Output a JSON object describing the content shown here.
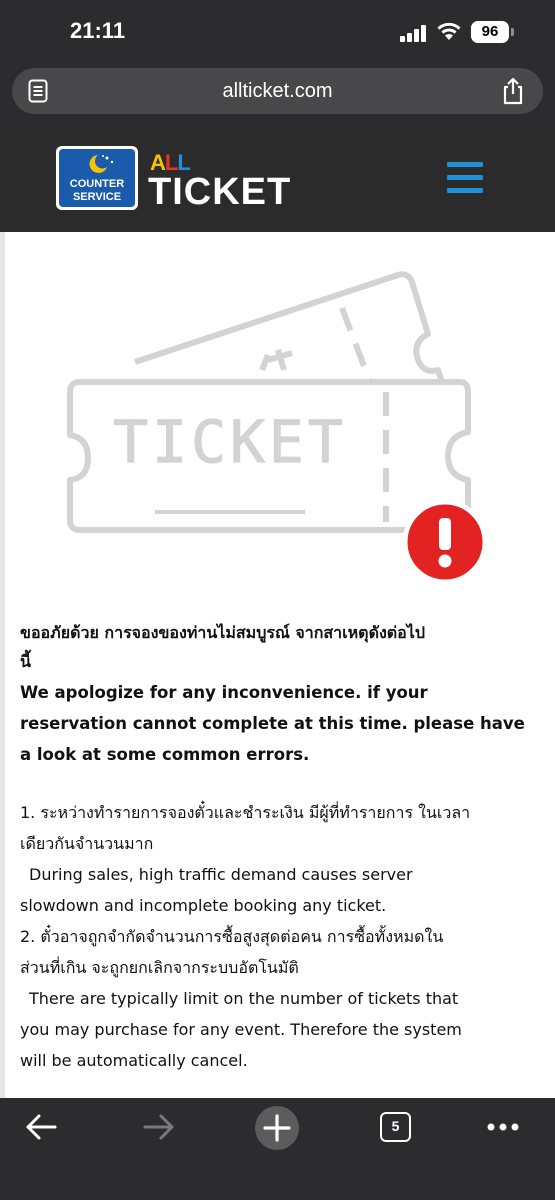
{
  "status_bar": {
    "time": "21:11",
    "battery": "96"
  },
  "browser": {
    "url": "allticket.com",
    "tab_count": "5"
  },
  "header": {
    "cs_logo_text": [
      "COUNTER",
      "SERVICE"
    ],
    "all_text": [
      "A",
      "L",
      "L"
    ],
    "brand": "TICKET",
    "all_colors": [
      "#f5c400",
      "#e8322c",
      "#1e90d6"
    ],
    "menu_color": "#1e90d6"
  },
  "illustration": {
    "ticket_word": "TICKET",
    "alert_mark": "!",
    "alert_color": "#e32222"
  },
  "message": {
    "heading_th": "ขออภัยด้วย การจองของท่านไม่สมบูรณ์ จากสาเหตุดังต่อไป นี้",
    "heading_th_lines": [
      "ขออภัยด้วย การจองของท่านไม่สมบูรณ์ จากสาเหตุดังต่อไป",
      "นี้"
    ],
    "heading_en_lines": [
      "We apologize for any inconvenience. if your",
      "reservation cannot complete at this time. please have",
      "a look at some common errors."
    ],
    "item1_th_lines": [
      "1. ระหว่างทำรายการจองตั๋วและชำระเงิน มีผู้ที่ทำรายการ ในเวลา",
      "เดียวกันจำนวนมาก"
    ],
    "item1_en_lines": [
      "During sales, high traffic demand causes server",
      "slowdown and incomplete booking any ticket."
    ],
    "item2_th_lines": [
      "2. ตั๋วอาจถูกจำกัดจำนวนการซื้อสูงสุดต่อคน การซื้อทั้งหมดใน",
      "ส่วนที่เกิน จะถูกยกเลิกจากระบบอัตโนมัติ"
    ],
    "item2_en_lines": [
      "There are typically limit on the number of tickets that",
      "you may purchase for any event. Therefore the system",
      "will be automatically cancel."
    ]
  }
}
